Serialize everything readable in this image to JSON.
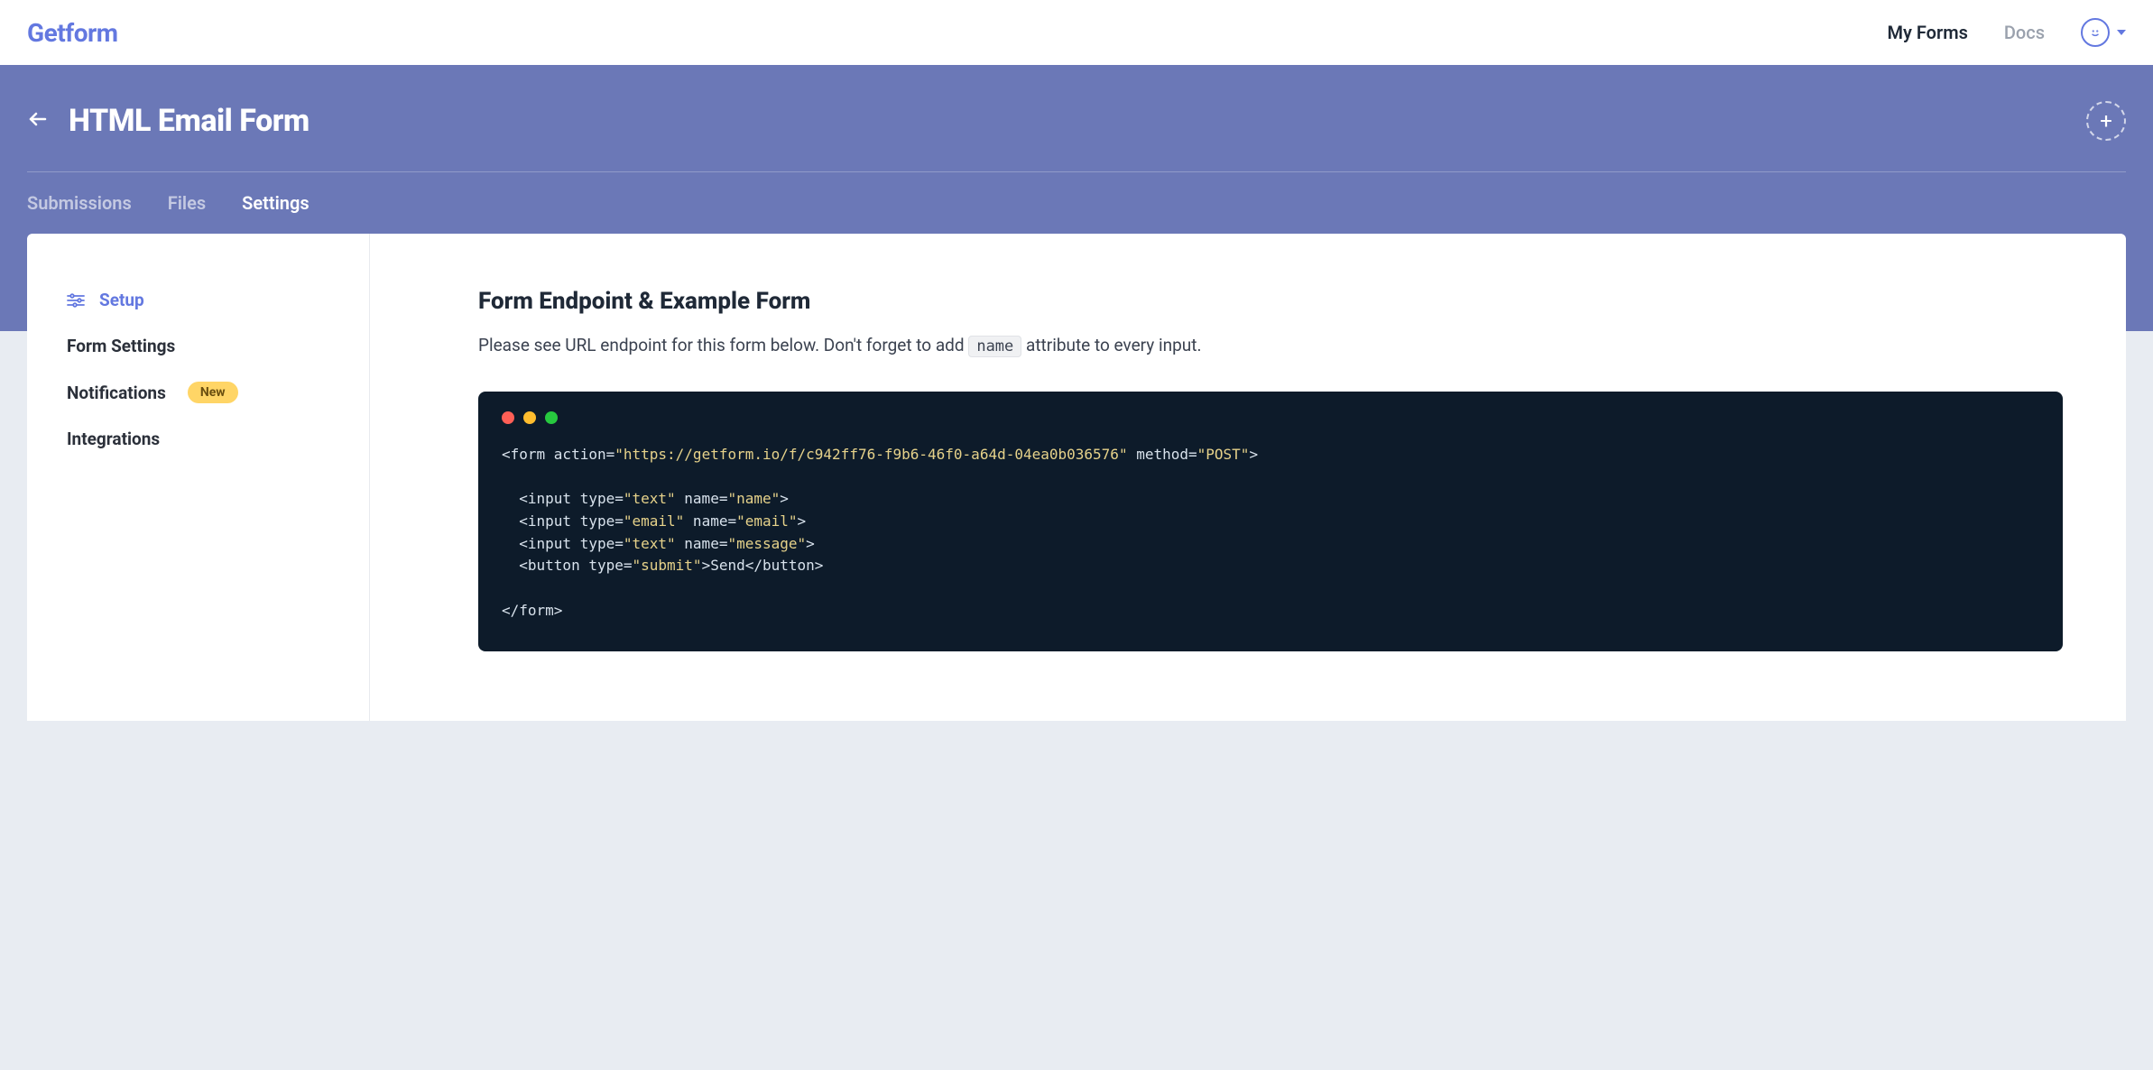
{
  "brand": "Getform",
  "topnav": {
    "my_forms": "My Forms",
    "docs": "Docs"
  },
  "page_title": "HTML Email Form",
  "tabs": {
    "submissions": "Submissions",
    "files": "Files",
    "settings": "Settings"
  },
  "sidebar": {
    "setup": "Setup",
    "form_settings": "Form Settings",
    "notifications": "Notifications",
    "notifications_badge": "New",
    "integrations": "Integrations"
  },
  "main": {
    "heading": "Form Endpoint & Example Form",
    "desc_before": "Please see URL endpoint for this form below. Don't forget to add ",
    "desc_code": "name",
    "desc_after": " attribute to every input.",
    "code": {
      "action_url": "https://getform.io/f/c942ff76-f9b6-46f0-a64d-04ea0b036576",
      "method": "POST",
      "inputs": [
        {
          "type": "text",
          "name": "name"
        },
        {
          "type": "email",
          "name": "email"
        },
        {
          "type": "text",
          "name": "message"
        }
      ],
      "button_type": "submit",
      "button_text": "Send"
    }
  }
}
